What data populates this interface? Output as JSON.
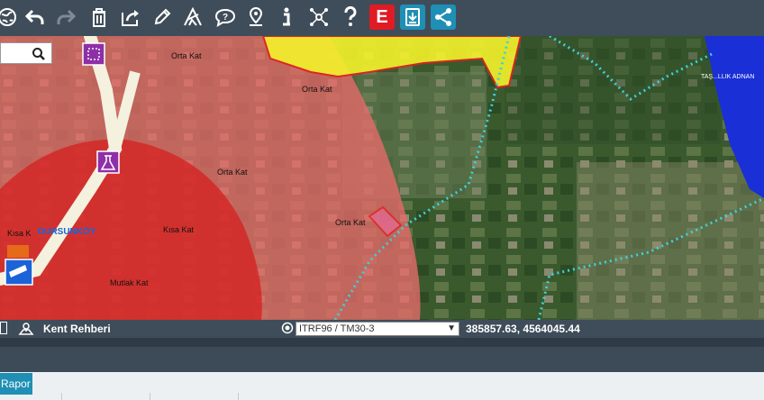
{
  "toolbar": {
    "icons": [
      "globe-icon",
      "undo-icon",
      "redo-icon",
      "trash-icon",
      "share-export-icon",
      "pencil-icon",
      "measure-icon",
      "comment-icon",
      "location-pin-icon",
      "info-icon",
      "network-icon",
      "help-icon",
      "e-icon",
      "download-icon",
      "share-icon"
    ],
    "e_label": "E"
  },
  "map": {
    "labels": {
      "orta_kat_1": "Orta Kat",
      "orta_kat_2": "Orta Kat",
      "orta_kat_3": "Orta Kat",
      "orta_kat_4": "Orta Kat",
      "kisa_kat_1": "Kısa Kat",
      "kisa_kat_2": "Kısa K",
      "mutlak_kat": "Mutlak Kat",
      "town": "DURSUNKÖY",
      "tr_label": "TAŞ...LLIK ADNAN"
    },
    "colors": {
      "red_zone": "#d61f1f",
      "pink_zone": "#e86a6a",
      "yellow_zone": "#f5f22b",
      "blue_zone": "#1a2fd6",
      "dotted_line": "#3fd0d8",
      "road": "#f4f1de"
    }
  },
  "statusbar": {
    "title": "Kent Rehberi",
    "crs": "ITRF96 / TM30-3",
    "coordinates": "385857.63, 4564045.44"
  },
  "bottom_panel": {
    "tab_label": "Rapor"
  }
}
